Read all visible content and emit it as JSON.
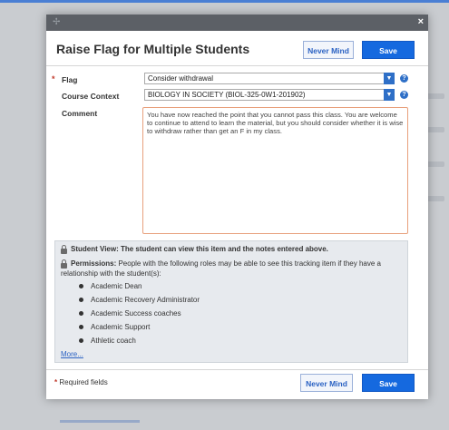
{
  "dialog": {
    "title": "Raise Flag for Multiple Students",
    "close_glyph": "×",
    "never_mind_label": "Never Mind",
    "save_label": "Save"
  },
  "form": {
    "flag_label": "Flag",
    "flag_value": "Consider withdrawal",
    "course_context_label": "Course Context",
    "course_context_value": "BIOLOGY IN SOCIETY (BIOL-325-0W1-201902)",
    "comment_label": "Comment",
    "comment_value": "You have now reached the point that you cannot pass this class.  You are welcome to continue to attend to learn the material, but you should consider whether it is wise to withdraw rather than get an F in my class.",
    "help_glyph": "?",
    "required_marker": "*"
  },
  "info": {
    "student_view": "Student View: The student can view this item and the notes entered above.",
    "permissions_label": "Permissions:",
    "permissions_text": " People with the following roles may be able to see this tracking item if they have a",
    "permissions_text_2": "relationship with the student(s):",
    "roles": [
      "Academic Dean",
      "Academic Recovery Administrator",
      "Academic Success coaches",
      "Academic Support",
      "Athletic coach"
    ],
    "more_link": "More..."
  },
  "footer": {
    "required_fields": "Required fields"
  },
  "colors": {
    "primary_button": "#1569df",
    "title_bar": "#5c6066",
    "required": "#c0392b",
    "comment_border": "#e8a07c"
  }
}
